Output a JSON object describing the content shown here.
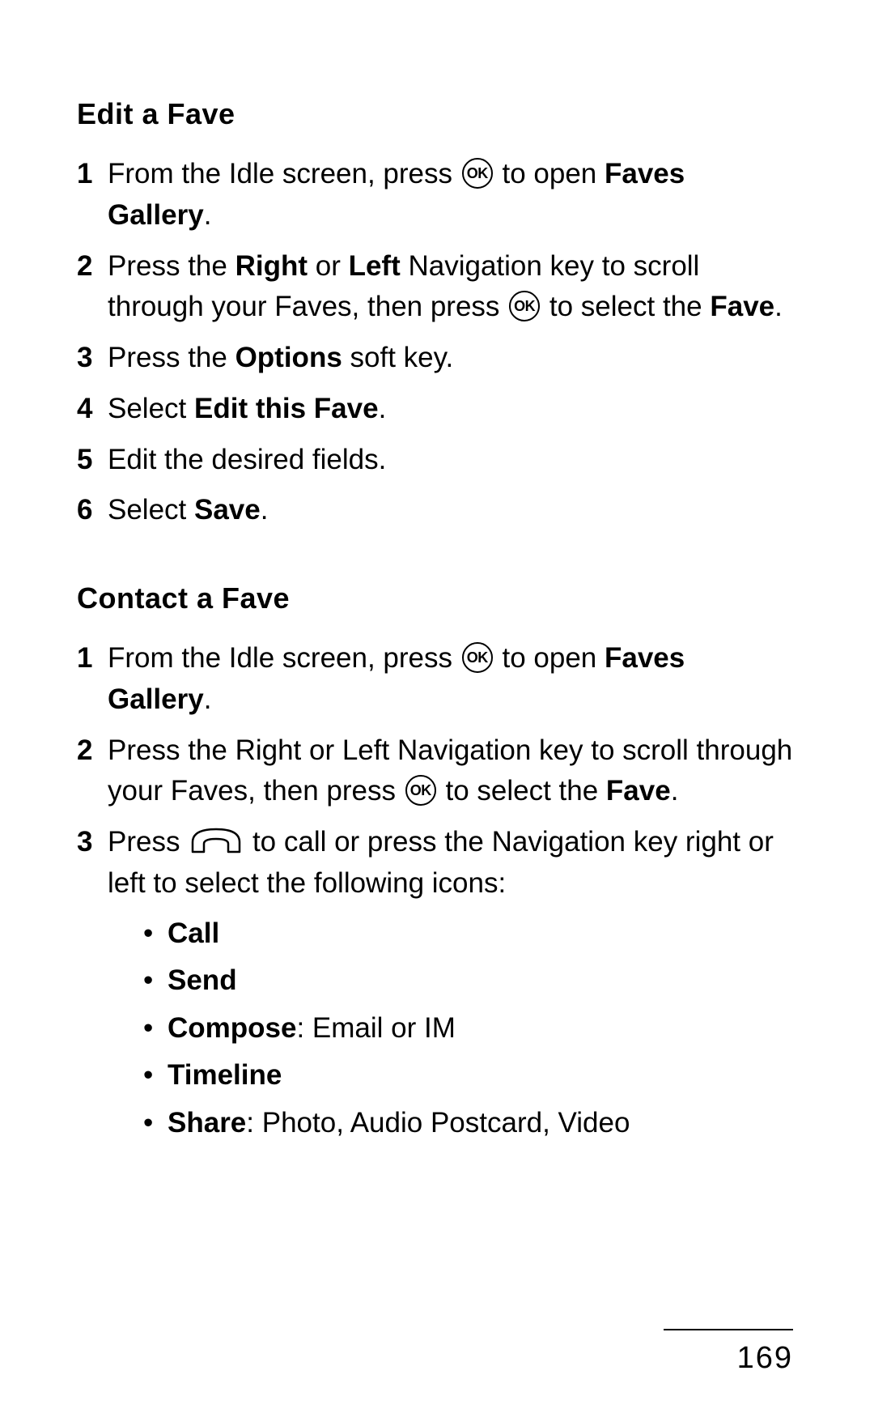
{
  "icons": {
    "ok_label": "OK"
  },
  "section1": {
    "heading": "Edit a Fave",
    "step1_a": "From the Idle screen, press ",
    "step1_b": " to open ",
    "step1_c": "Faves Gallery",
    "step1_d": ".",
    "step2_a": "Press the ",
    "step2_b": "Right",
    "step2_c": " or ",
    "step2_d": "Left",
    "step2_e": " Navigation key to scroll through your Faves, then press ",
    "step2_f": " to select the ",
    "step2_g": "Fave",
    "step2_h": ".",
    "step3_a": "Press the ",
    "step3_b": "Options",
    "step3_c": " soft key.",
    "step4_a": "Select ",
    "step4_b": "Edit this Fave",
    "step4_c": ".",
    "step5": "Edit the desired fields.",
    "step6_a": "Select ",
    "step6_b": "Save",
    "step6_c": "."
  },
  "section2": {
    "heading": "Contact a Fave",
    "step1_a": "From the Idle screen, press ",
    "step1_b": " to open ",
    "step1_c": "Faves Gallery",
    "step1_d": ".",
    "step2_a": "Press the Right or Left Navigation key to scroll through your Faves, then press ",
    "step2_b": " to select the ",
    "step2_c": "Fave",
    "step2_d": ".",
    "step3_a": "Press ",
    "step3_b": " to call or press the Navigation key right or left to select the following icons:",
    "bullets": {
      "b1": "Call",
      "b2": "Send",
      "b3_a": "Compose",
      "b3_b": ": Email or IM",
      "b4": "Timeline",
      "b5_a": "Share",
      "b5_b": ": Photo, Audio Postcard, Video"
    }
  },
  "page_number": "169"
}
